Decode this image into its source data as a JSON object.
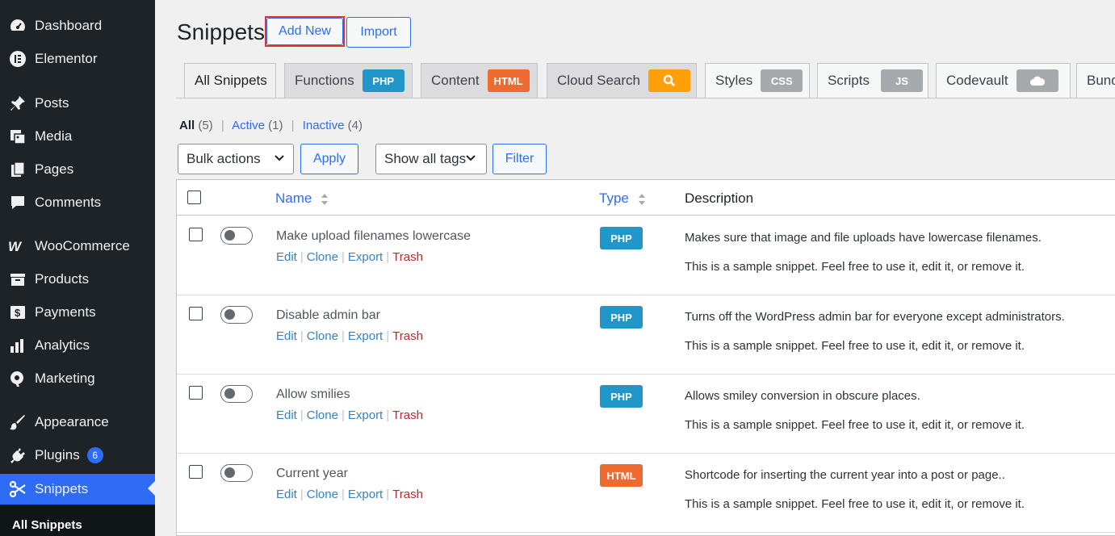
{
  "colors": {
    "sidebar_bg": "#1d2327",
    "accent": "#2f6cf5",
    "php": "#2196c9",
    "html": "#ed6a31",
    "search": "#ff9f0a",
    "css_js": "#a7aaad",
    "trash": "#b32d2e",
    "highlight": "#d63638"
  },
  "sidebar": {
    "items": [
      {
        "label": "Dashboard",
        "icon": "dashboard-icon"
      },
      {
        "label": "Elementor",
        "icon": "elementor-icon"
      },
      {
        "label": "Posts",
        "icon": "pin-icon"
      },
      {
        "label": "Media",
        "icon": "media-icon"
      },
      {
        "label": "Pages",
        "icon": "pages-icon"
      },
      {
        "label": "Comments",
        "icon": "comment-icon"
      },
      {
        "label": "WooCommerce",
        "icon": "woo-icon"
      },
      {
        "label": "Products",
        "icon": "archive-icon"
      },
      {
        "label": "Payments",
        "icon": "payments-icon"
      },
      {
        "label": "Analytics",
        "icon": "analytics-icon"
      },
      {
        "label": "Marketing",
        "icon": "megaphone-icon"
      },
      {
        "label": "Appearance",
        "icon": "brush-icon"
      },
      {
        "label": "Plugins",
        "icon": "plugin-icon",
        "badge": "6"
      },
      {
        "label": "Snippets",
        "icon": "scissors-icon"
      }
    ],
    "submenu_current": "All Snippets"
  },
  "header": {
    "title": "Snippets",
    "add_new": "Add New",
    "import": "Import"
  },
  "tabs": [
    {
      "label": "All Snippets"
    },
    {
      "label": "Functions",
      "pill": "PHP"
    },
    {
      "label": "Content",
      "pill": "HTML"
    },
    {
      "label": "Cloud Search",
      "pill_icon": "search-icon"
    },
    {
      "label": "Styles",
      "pill": "CSS"
    },
    {
      "label": "Scripts",
      "pill": "JS"
    },
    {
      "label": "Codevault",
      "pill_icon": "cloud-icon"
    },
    {
      "label": "Bund"
    }
  ],
  "views": {
    "all": "All",
    "all_count": "(5)",
    "active": "Active",
    "active_count": "(1)",
    "inactive": "Inactive",
    "inactive_count": "(4)",
    "sep": "|"
  },
  "filters": {
    "bulk_actions": "Bulk actions",
    "apply": "Apply",
    "tags": "Show all tags",
    "filter": "Filter"
  },
  "table": {
    "columns": {
      "name": "Name",
      "type": "Type",
      "description": "Description"
    },
    "action_labels": {
      "edit": "Edit",
      "clone": "Clone",
      "export": "Export",
      "trash": "Trash"
    },
    "rows": [
      {
        "name": "Make upload filenames lowercase",
        "type": "PHP",
        "description": "Makes sure that image and file uploads have lowercase filenames.",
        "note": "This is a sample snippet. Feel free to use it, edit it, or remove it."
      },
      {
        "name": "Disable admin bar",
        "type": "PHP",
        "description": "Turns off the WordPress admin bar for everyone except administrators.",
        "note": "This is a sample snippet. Feel free to use it, edit it, or remove it."
      },
      {
        "name": "Allow smilies",
        "type": "PHP",
        "description": "Allows smiley conversion in obscure places.",
        "note": "This is a sample snippet. Feel free to use it, edit it, or remove it."
      },
      {
        "name": "Current year",
        "type": "HTML",
        "description": "Shortcode for inserting the current year into a post or page..",
        "note": "This is a sample snippet. Feel free to use it, edit it, or remove it."
      }
    ]
  }
}
